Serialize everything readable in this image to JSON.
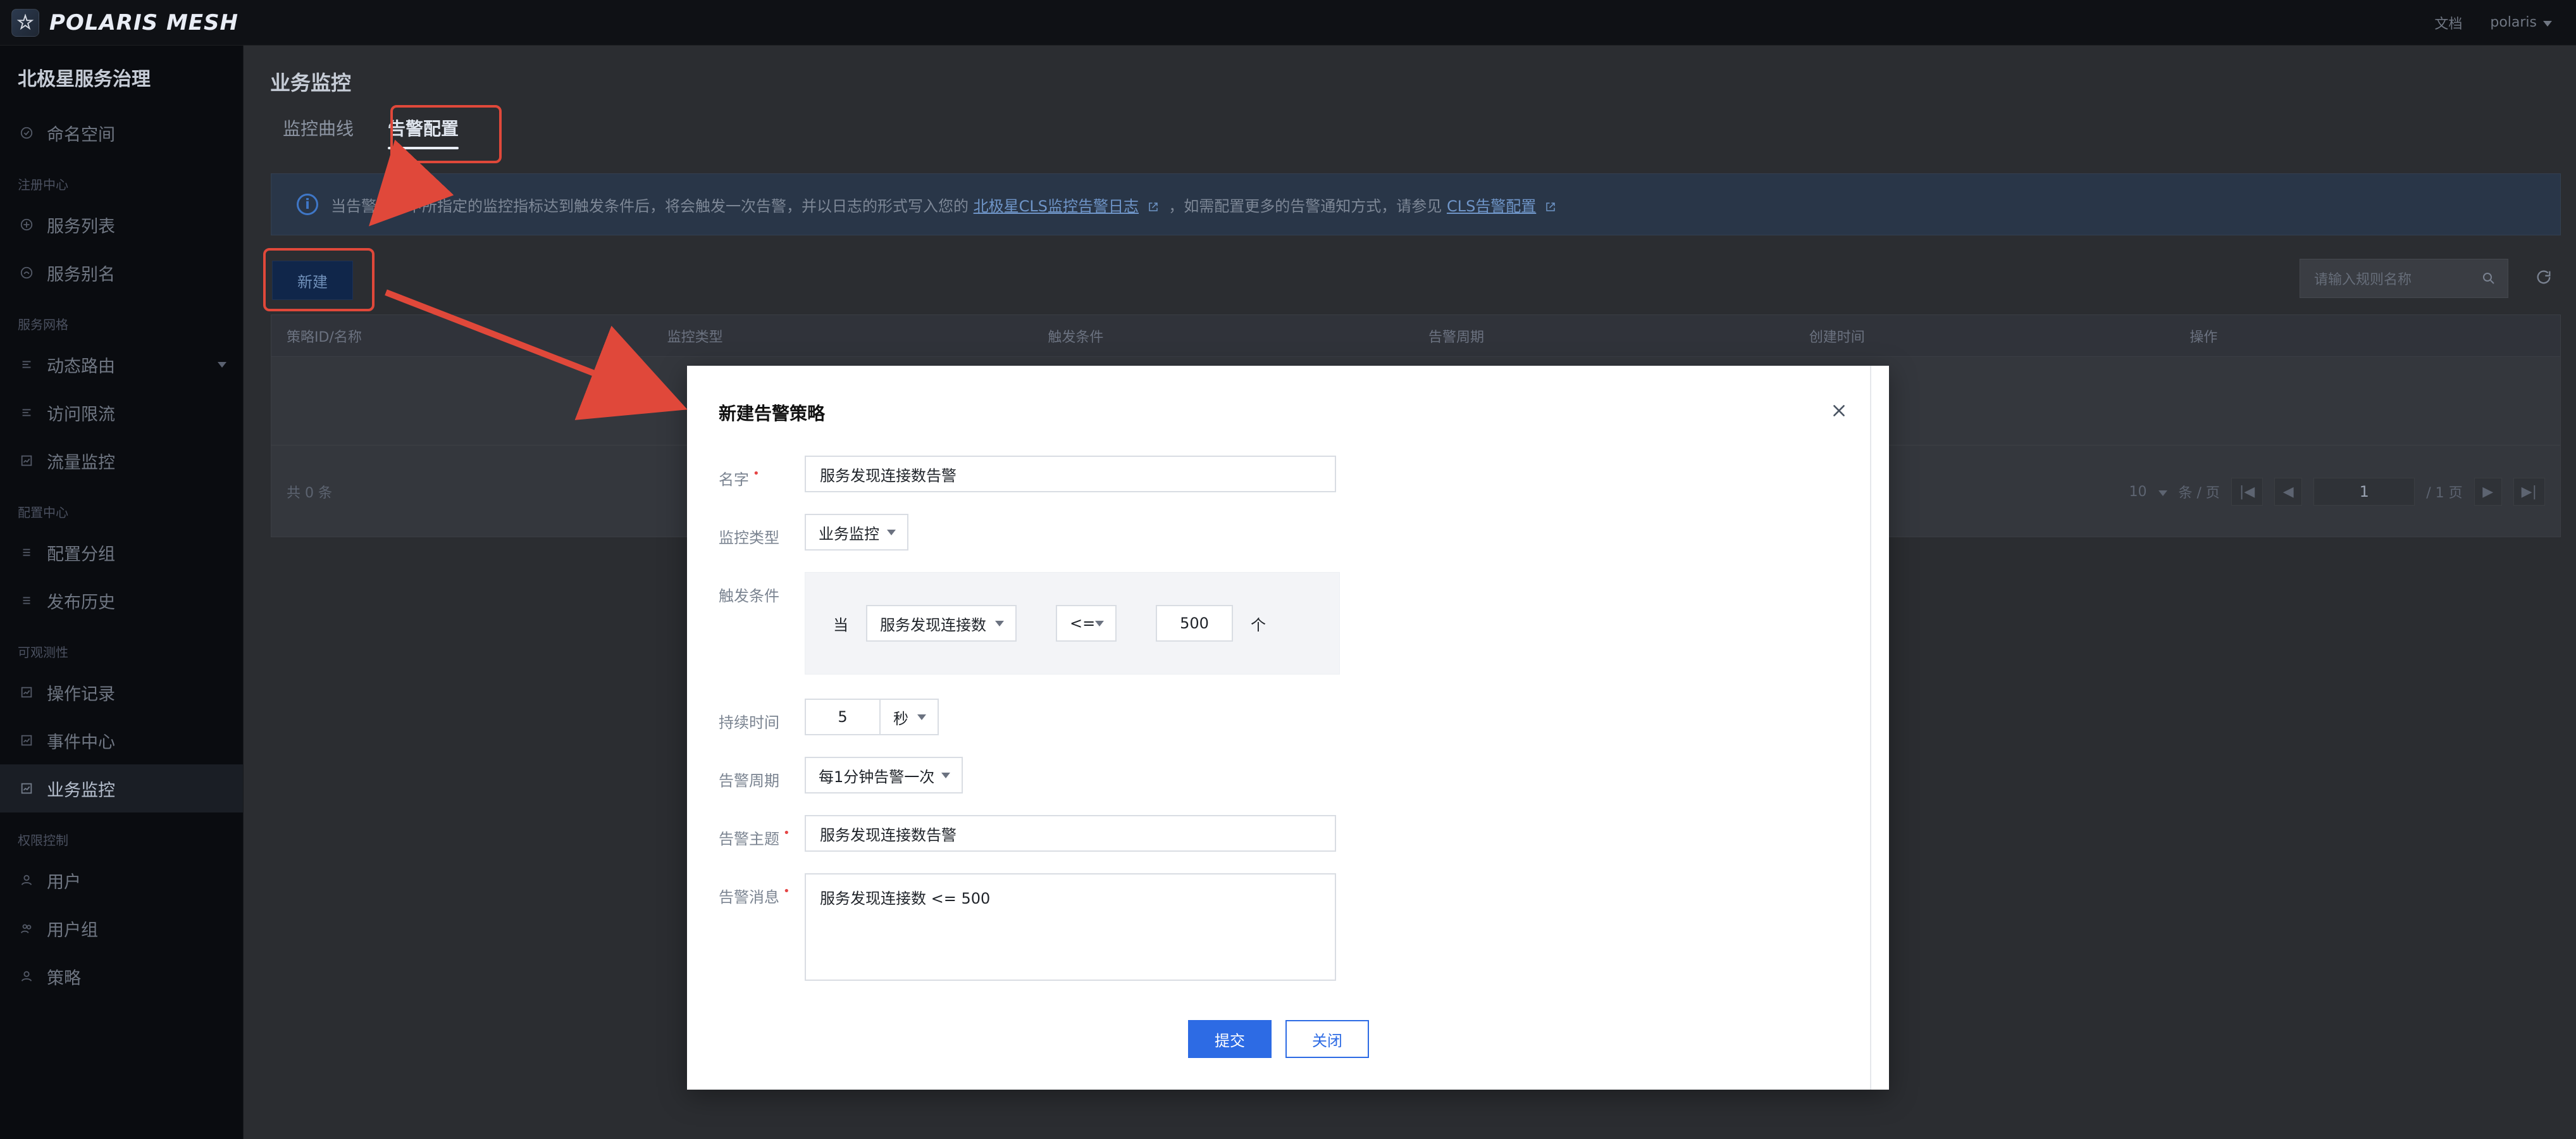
{
  "topbar": {
    "brand": "POLARIS MESH",
    "docs": "文档",
    "user": "polaris"
  },
  "sidebar": {
    "title": "北极星服务治理",
    "groups": {
      "registry": "注册中心",
      "mesh": "服务网格",
      "config": "配置中心",
      "observability": "可观测性",
      "access": "权限控制"
    },
    "items": [
      {
        "label": "命名空间",
        "icon": "namespace-icon"
      },
      {
        "label": "服务列表",
        "icon": "service-list-icon"
      },
      {
        "label": "服务别名",
        "icon": "service-alias-icon"
      },
      {
        "label": "动态路由",
        "icon": "route-icon"
      },
      {
        "label": "访问限流",
        "icon": "ratelimit-icon"
      },
      {
        "label": "流量监控",
        "icon": "traffic-monitor-icon"
      },
      {
        "label": "配置分组",
        "icon": "config-group-icon"
      },
      {
        "label": "发布历史",
        "icon": "release-history-icon"
      },
      {
        "label": "操作记录",
        "icon": "audit-log-icon"
      },
      {
        "label": "事件中心",
        "icon": "event-center-icon"
      },
      {
        "label": "业务监控",
        "icon": "business-monitor-icon"
      },
      {
        "label": "用户",
        "icon": "user-icon"
      },
      {
        "label": "用户组",
        "icon": "user-group-icon"
      },
      {
        "label": "策略",
        "icon": "policy-icon"
      }
    ]
  },
  "main": {
    "page_title": "业务监控",
    "tabs": [
      {
        "label": "监控曲线"
      },
      {
        "label": "告警配置"
      }
    ],
    "banner": {
      "text_prefix": "当告警策略中所指定的监控指标达到触发条件后，将会触发一次告警，并以日志的形式写入您的",
      "link1": "北极星CLS监控告警日志",
      "text_mid": "，如需配置更多的告警通知方式，请参见",
      "link2": "CLS告警配置"
    },
    "new_button": "新建",
    "search_placeholder": "请输入规则名称",
    "table": {
      "headers": [
        "策略ID/名称",
        "监控类型",
        "触发条件",
        "告警周期",
        "创建时间",
        "操作"
      ],
      "total": "共 0 条",
      "pager": {
        "page_size": "10",
        "page_size_suffix": "条 / 页",
        "current_page": "1",
        "total_pages": "/ 1 页"
      }
    }
  },
  "modal": {
    "title": "新建告警策略",
    "fields": {
      "name_label": "名字",
      "name_value": "服务发现连接数告警",
      "monitor_type_label": "监控类型",
      "monitor_type_value": "业务监控",
      "trigger_label": "触发条件",
      "trigger_when": "当",
      "trigger_metric": "服务发现连接数",
      "trigger_operator": "<=",
      "trigger_value": "500",
      "trigger_unit": "个",
      "duration_label": "持续时间",
      "duration_value": "5",
      "duration_unit": "秒",
      "period_label": "告警周期",
      "period_value": "每1分钟告警一次",
      "topic_label": "告警主题",
      "topic_value": "服务发现连接数告警",
      "message_label": "告警消息",
      "message_value": "服务发现连接数 <= 500"
    },
    "submit": "提交",
    "close": "关闭"
  }
}
